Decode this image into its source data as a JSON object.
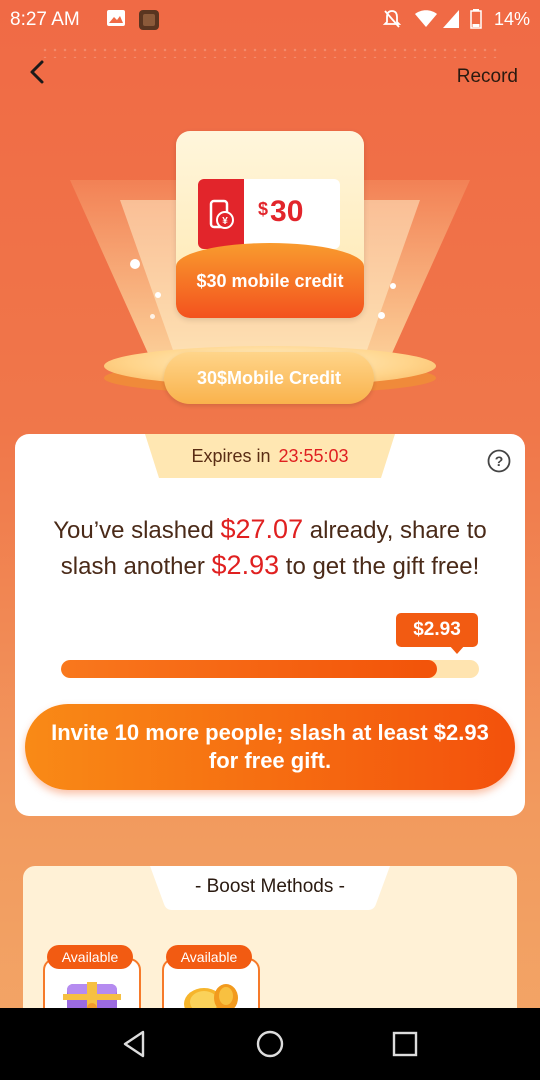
{
  "status_bar": {
    "time": "8:27 AM",
    "battery": "14%"
  },
  "header": {
    "record_label": "Record"
  },
  "prize": {
    "ticket_currency": "$",
    "ticket_amount": "30",
    "card_label": "$30 mobile credit",
    "stage_label": "30$Mobile Credit"
  },
  "countdown": {
    "label": "Expires in",
    "time": "23:55:03"
  },
  "progress": {
    "text_1": "You’ve slashed ",
    "slashed": "$27.07",
    "text_2": " already, share to slash another ",
    "remaining": "$2.93",
    "text_3": " to get the gift free!",
    "badge": "$2.93",
    "fraction": 0.9
  },
  "invite_button": {
    "label": "Invite 10 more people; slash at least $2.93 for free gift."
  },
  "boost": {
    "title": "- Boost Methods -",
    "methods": [
      {
        "badge": "Available",
        "icon": "treasure-chest-icon"
      },
      {
        "badge": "Available",
        "icon": "gold-coins-icon"
      }
    ]
  },
  "colors": {
    "accent": "#F25B12",
    "highlight": "#E02020",
    "background": "#F06A45"
  }
}
